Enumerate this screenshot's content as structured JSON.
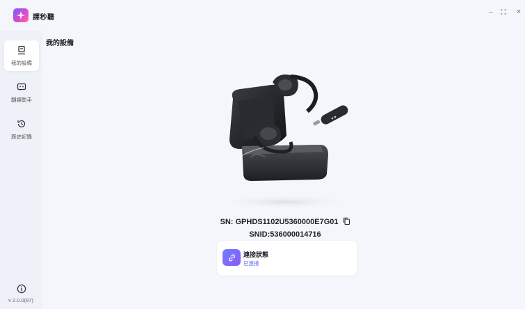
{
  "app": {
    "title": "譯秒聽"
  },
  "window_controls": {
    "minimize": "–",
    "maximize": "⛶",
    "close": "×"
  },
  "sidebar": {
    "items": [
      {
        "label": "我的設備",
        "icon": "device-icon",
        "active": true
      },
      {
        "label": "翻譯助手",
        "icon": "translate-icon",
        "active": false
      },
      {
        "label": "歷史記錄",
        "icon": "history-icon",
        "active": false
      }
    ],
    "version": "v 2.0.0(87)"
  },
  "main": {
    "title": "我的設備",
    "device": {
      "sn": "SN: GPHDS1102U5360000E7G01",
      "snid": "SNID:536000014716"
    },
    "status": {
      "title": "連接狀態",
      "value": "已連接"
    }
  },
  "colors": {
    "accent": "#5b6cff",
    "brand_gradient": [
      "#7b5cff",
      "#ff6a8a"
    ]
  }
}
